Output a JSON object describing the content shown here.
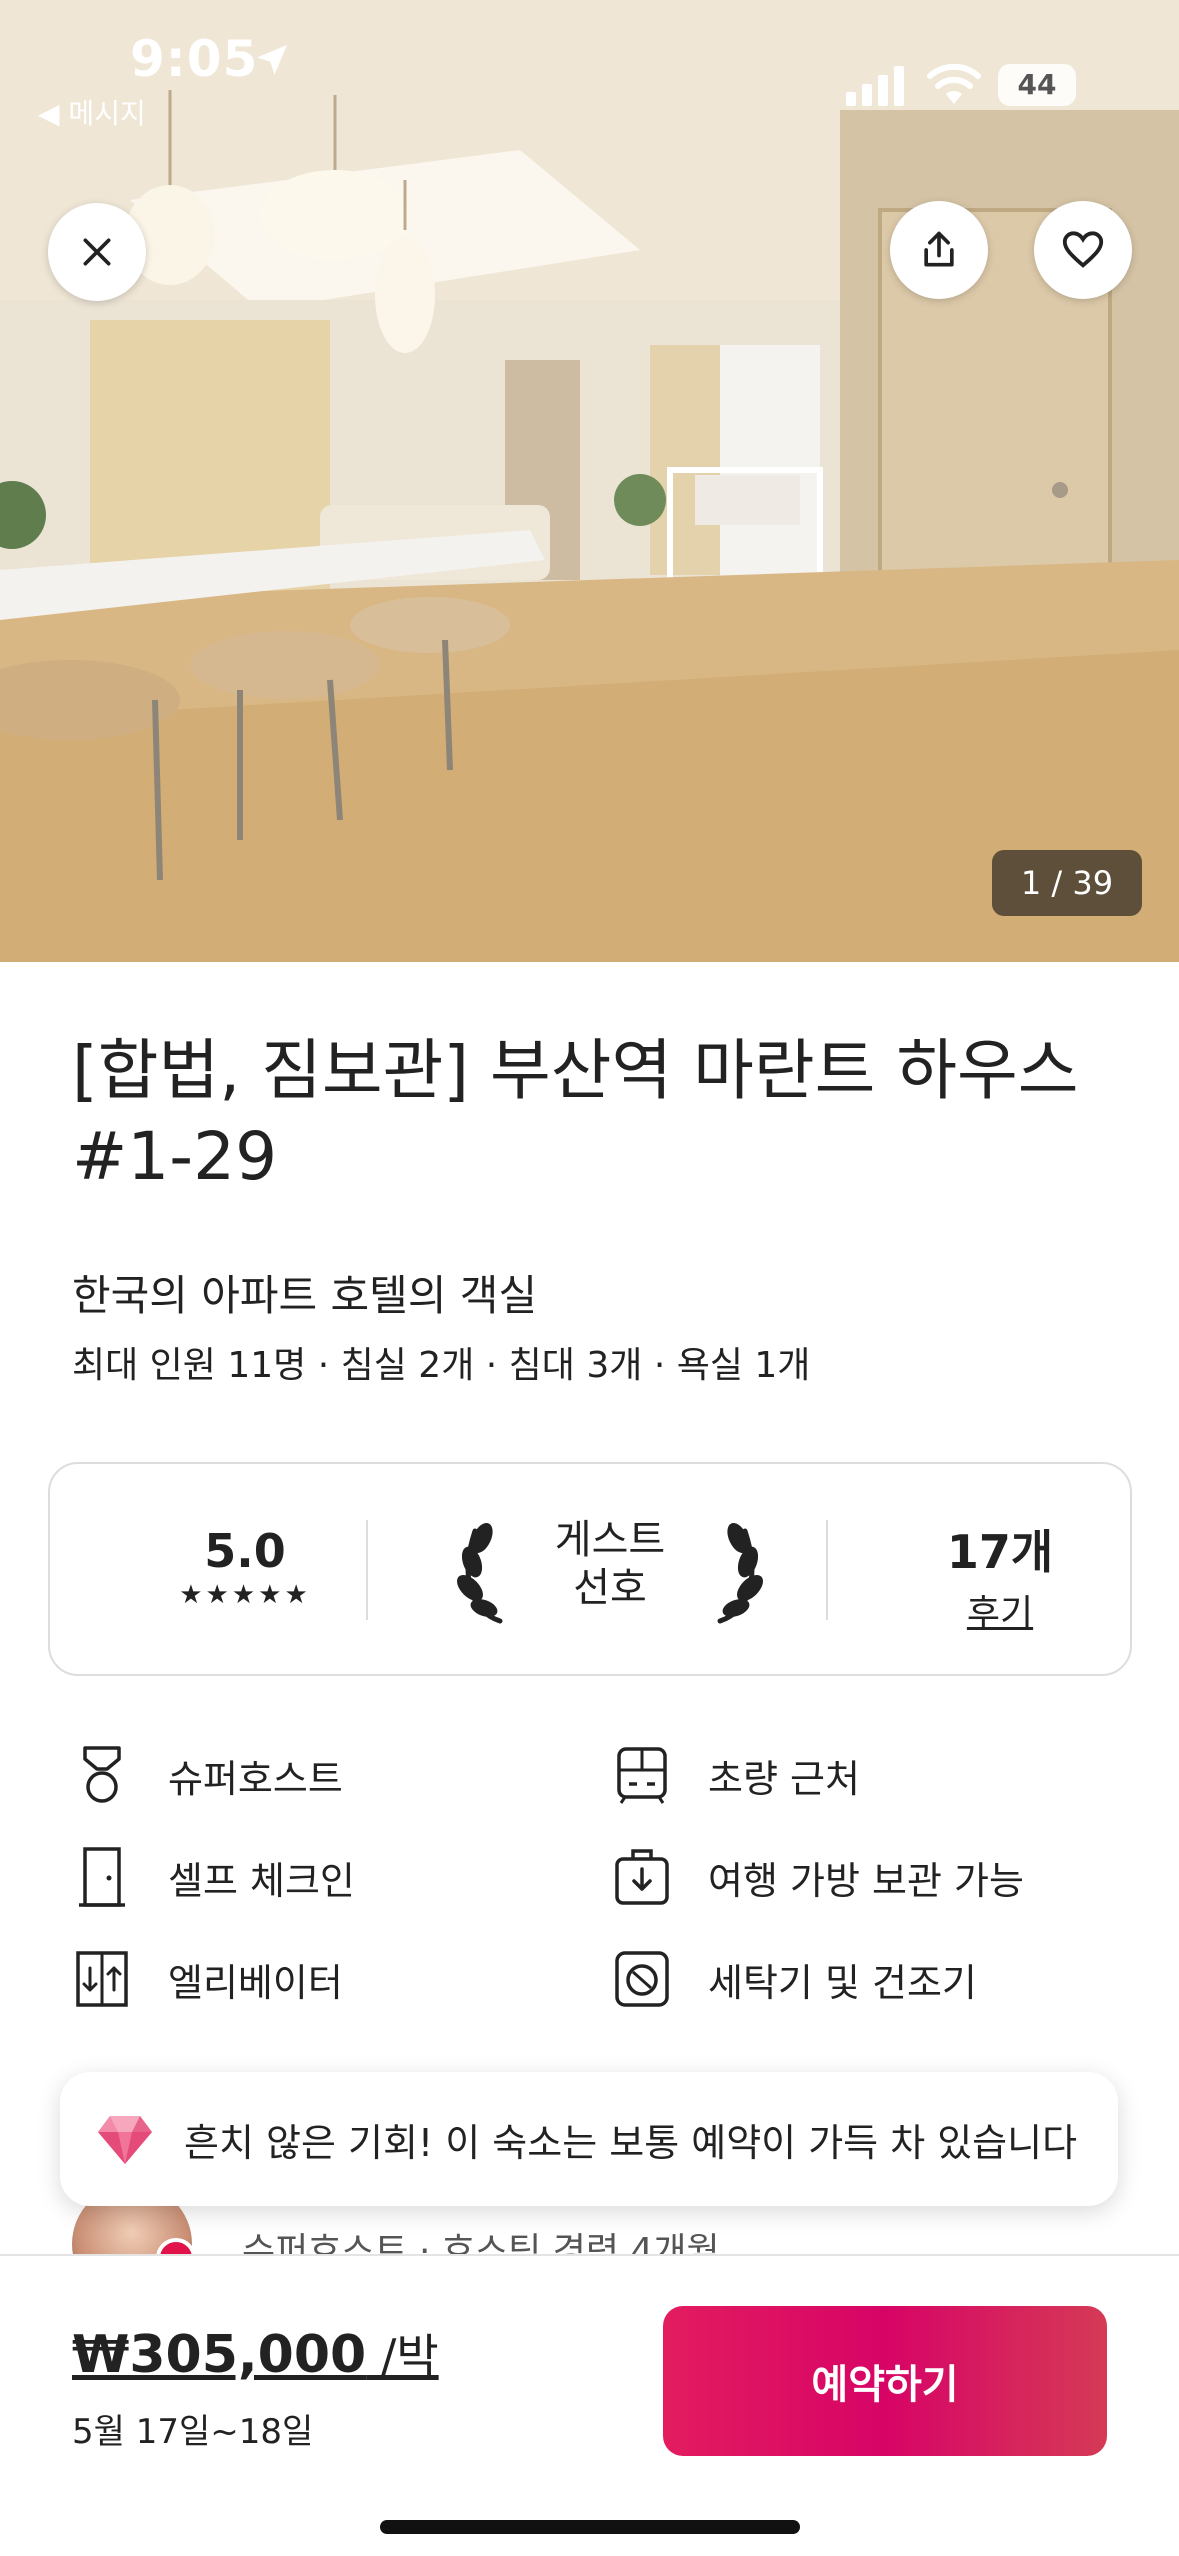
{
  "status_bar": {
    "time": "9:05",
    "back_app": "◀ 메시지",
    "battery": "44"
  },
  "gallery": {
    "counter": "1 / 39"
  },
  "listing": {
    "title": "[합법, 짐보관] 부산역 마란트 하우스 #1-29",
    "subtitle": "한국의 아파트 호텔의 객실",
    "specs": "최대 인원 11명 · 침실 2개 · 침대 3개 · 욕실 1개"
  },
  "stats": {
    "rating": "5.0",
    "stars": "★★★★★",
    "stars_value": 5,
    "guest_favorite": "게스트\n선호",
    "reviews_count": "17개",
    "reviews_label": "후기"
  },
  "amenities": [
    {
      "label": "슈퍼호스트",
      "icon": "medal-icon"
    },
    {
      "label": "초량 근처",
      "icon": "train-icon"
    },
    {
      "label": "셀프 체크인",
      "icon": "door-icon"
    },
    {
      "label": "여행 가방 보관 가능",
      "icon": "luggage-icon"
    },
    {
      "label": "엘리베이터",
      "icon": "elevator-icon"
    },
    {
      "label": "세탁기 및 건조기",
      "icon": "washer-icon"
    }
  ],
  "toast": {
    "message": "흔치 않은 기회! 이 숙소는 보통 예약이 가득 차 있습니다"
  },
  "host": {
    "line": "슈퍼호스트 · 호스팅 경력 4개월"
  },
  "booking": {
    "price": "₩305,000",
    "per": " /박",
    "dates": "5월 17일~18일",
    "reserve_label": "예약하기"
  },
  "colors": {
    "brand": "#e31c5f",
    "text": "#222222",
    "border": "#dddddd"
  }
}
